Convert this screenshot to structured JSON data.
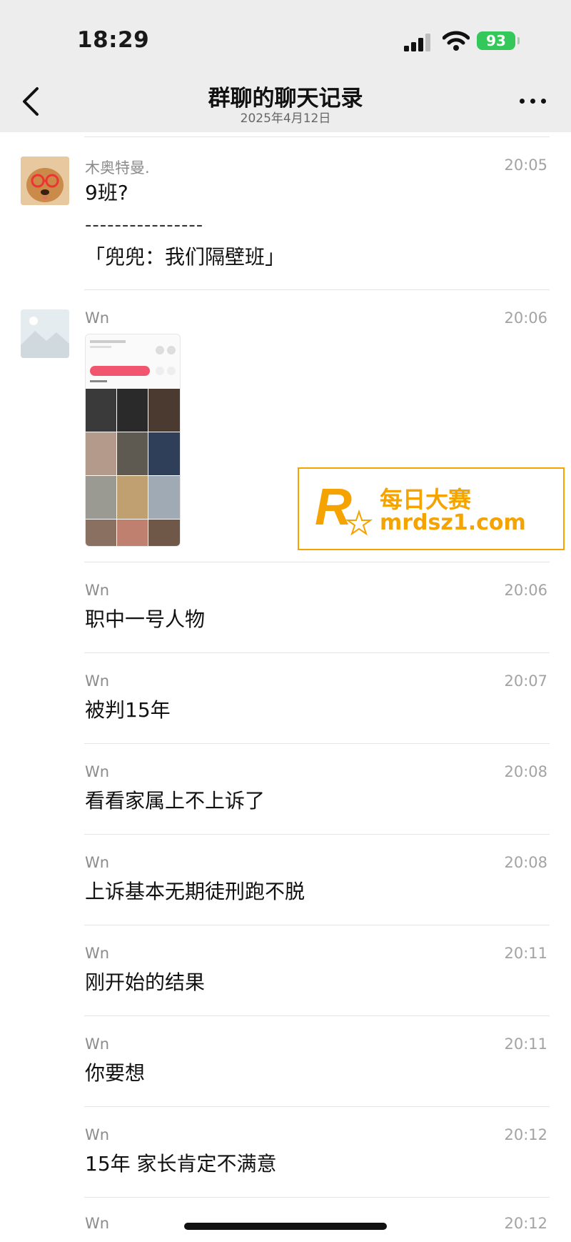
{
  "status": {
    "time": "18:29",
    "battery": "93"
  },
  "nav": {
    "title": "群聊的聊天记录",
    "subtitle": "2025年4月12日"
  },
  "messages": [
    {
      "sender": "木奥特曼.",
      "time": "20:05",
      "text": "9班?",
      "separator": "----------------",
      "quote": "「兜兜：我们隔壁班」"
    },
    {
      "sender": "Wn",
      "time": "20:06",
      "type": "image"
    },
    {
      "sender": "Wn",
      "time": "20:06",
      "text": "职中一号人物"
    },
    {
      "sender": "Wn",
      "time": "20:07",
      "text": "被判15年"
    },
    {
      "sender": "Wn",
      "time": "20:08",
      "text": "看看家属上不上诉了"
    },
    {
      "sender": "Wn",
      "time": "20:08",
      "text": "上诉基本无期徒刑跑不脱"
    },
    {
      "sender": "Wn",
      "time": "20:11",
      "text": "刚开始的结果"
    },
    {
      "sender": "Wn",
      "time": "20:11",
      "text": "你要想"
    },
    {
      "sender": "Wn",
      "time": "20:12",
      "text": "15年 家长肯定不满意"
    },
    {
      "sender": "Wn",
      "time": "20:12"
    }
  ],
  "watermark": {
    "name": "每日大赛",
    "url": "mrdsz1.com"
  },
  "colors": {
    "topbar": "#ededed",
    "battery": "#34c759",
    "watermark": "#f5a300"
  },
  "icons": [
    "back-chevron-icon",
    "more-dots-icon",
    "signal-icon",
    "wifi-icon",
    "battery-icon"
  ]
}
